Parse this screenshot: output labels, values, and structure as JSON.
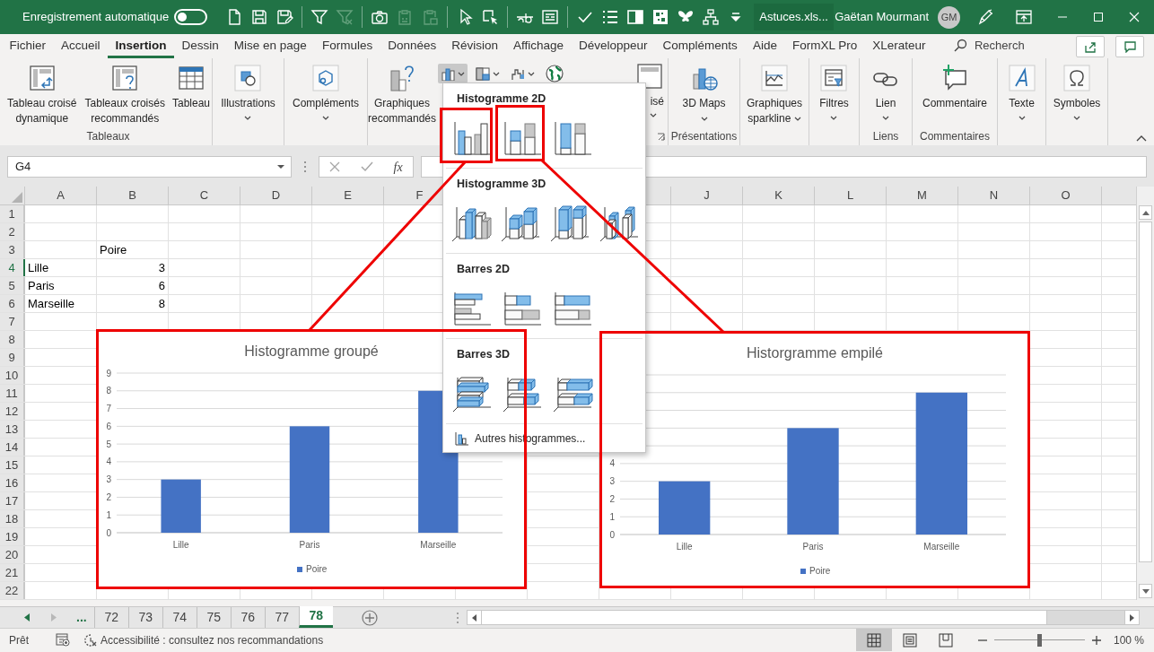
{
  "title_bar": {
    "autosave": {
      "label": "Enregistrement automatique",
      "on": false
    },
    "quick_access": [
      {
        "tools": [
          {
            "kind": "new-file",
            "disabled": false
          },
          {
            "kind": "save",
            "disabled": false
          },
          {
            "kind": "save-as",
            "disabled": false
          }
        ]
      },
      {
        "tools": [
          {
            "kind": "filter",
            "disabled": false
          },
          {
            "kind": "clear-filter",
            "disabled": true
          }
        ]
      },
      {
        "tools": [
          {
            "kind": "camera",
            "disabled": false
          },
          {
            "kind": "clipboard-numbers",
            "disabled": true
          },
          {
            "kind": "clipboard-picture",
            "disabled": true
          }
        ]
      },
      {
        "tools": [
          {
            "kind": "pointer",
            "disabled": false
          },
          {
            "kind": "select-objects",
            "disabled": false
          }
        ]
      },
      {
        "tools": [
          {
            "kind": "strikethrough",
            "disabled": false
          },
          {
            "kind": "form",
            "disabled": false
          }
        ]
      },
      {
        "tools": [
          {
            "kind": "check",
            "disabled": false
          },
          {
            "kind": "list",
            "disabled": false
          },
          {
            "kind": "layout",
            "disabled": false
          },
          {
            "kind": "checker",
            "disabled": false
          },
          {
            "kind": "butterfly",
            "disabled": false
          },
          {
            "kind": "org-chart",
            "disabled": false
          },
          {
            "kind": "more",
            "disabled": false
          }
        ]
      }
    ],
    "file_name": "Astuces.xls...",
    "user": "Gaëtan Mourmant",
    "avatar": "GM"
  },
  "tabs": [
    {
      "label": "Fichier",
      "selected": false
    },
    {
      "label": "Accueil",
      "selected": false
    },
    {
      "label": "Insertion",
      "selected": true
    },
    {
      "label": "Dessin",
      "selected": false
    },
    {
      "label": "Mise en page",
      "selected": false
    },
    {
      "label": "Formules",
      "selected": false
    },
    {
      "label": "Données",
      "selected": false
    },
    {
      "label": "Révision",
      "selected": false
    },
    {
      "label": "Affichage",
      "selected": false
    },
    {
      "label": "Développeur",
      "selected": false
    },
    {
      "label": "Compléments",
      "selected": false
    },
    {
      "label": "Aide",
      "selected": false
    },
    {
      "label": "FormXL Pro",
      "selected": false
    },
    {
      "label": "XLerateur",
      "selected": false
    }
  ],
  "search": {
    "placeholder": "Recherch"
  },
  "ribbon": {
    "groups": [
      {
        "kind": "tables",
        "label": "Tableaux",
        "buttons": [
          {
            "kind": "pivot-table",
            "label": "Tableau croisé dynamique",
            "dropdown": false
          },
          {
            "kind": "recommended-pivot",
            "label": "Tableaux croisés recommandés",
            "dropdown": false
          },
          {
            "kind": "table",
            "label": "Tableau",
            "dropdown": false
          }
        ]
      },
      {
        "kind": "illustrations",
        "buttons": [
          {
            "kind": "shapes",
            "label": "Illustrations",
            "dropdown": true
          }
        ]
      },
      {
        "kind": "addins",
        "buttons": [
          {
            "kind": "addins",
            "label": "Compléments",
            "dropdown": true
          }
        ]
      },
      {
        "kind": "charts",
        "buttons": [
          {
            "kind": "recommended-charts",
            "label": "Graphiques recommandés",
            "dropdown": false
          }
        ],
        "small_buttons": [
          {
            "kind": "column",
            "pressed": true
          },
          {
            "kind": "hierarchy",
            "pressed": false
          },
          {
            "kind": "waterfall",
            "pressed": false
          },
          {
            "kind": "map",
            "pressed": false
          }
        ],
        "pivot_chart": {
          "label": "isé",
          "dropdown": true
        }
      },
      {
        "kind": "tours",
        "label": "Présentations",
        "buttons": [
          {
            "kind": "maps",
            "label": "3D Maps",
            "dropdown": true
          }
        ]
      },
      {
        "kind": "sparklines",
        "buttons": [
          {
            "kind": "sparkline",
            "label": "Graphiques sparkline",
            "dropdown": true
          }
        ]
      },
      {
        "kind": "filters",
        "buttons": [
          {
            "kind": "slicer",
            "label": "Filtres",
            "dropdown": true
          }
        ]
      },
      {
        "kind": "links",
        "label": "Liens",
        "buttons": [
          {
            "kind": "link",
            "label": "Lien",
            "dropdown": true
          }
        ]
      },
      {
        "kind": "comments",
        "label": "Commentaires",
        "buttons": [
          {
            "kind": "comment",
            "label": "Commentaire",
            "dropdown": false
          }
        ]
      },
      {
        "kind": "text",
        "buttons": [
          {
            "kind": "text",
            "label": "Texte",
            "dropdown": true
          }
        ]
      },
      {
        "kind": "symbols",
        "buttons": [
          {
            "kind": "symbol",
            "label": "Symboles",
            "dropdown": true
          }
        ]
      }
    ]
  },
  "formula_bar": {
    "name_box": "G4",
    "function_button": "fx"
  },
  "sheet": {
    "columns": [
      "A",
      "B",
      "C",
      "D",
      "E",
      "F",
      null,
      null,
      null,
      "J",
      "K",
      "L",
      "M",
      "N",
      "O"
    ],
    "rows": [
      {
        "header": "1",
        "active": false
      },
      {
        "header": "2",
        "active": false
      },
      {
        "header": "3",
        "active": false,
        "cells": [
          null,
          {
            "value": "Poire",
            "kind": "text"
          }
        ]
      },
      {
        "header": "4",
        "active": true,
        "cells": [
          {
            "value": "Lille",
            "kind": "text"
          },
          {
            "value": "3",
            "kind": "number"
          }
        ]
      },
      {
        "header": "5",
        "active": false,
        "cells": [
          {
            "value": "Paris",
            "kind": "text"
          },
          {
            "value": "6",
            "kind": "number"
          }
        ]
      },
      {
        "header": "6",
        "active": false,
        "cells": [
          {
            "value": "Marseille",
            "kind": "text"
          },
          {
            "value": "8",
            "kind": "number"
          }
        ]
      },
      {
        "header": "7",
        "active": false
      },
      {
        "header": "8",
        "active": false
      },
      {
        "header": "9",
        "active": false
      },
      {
        "header": "10",
        "active": false
      },
      {
        "header": "11",
        "active": false
      },
      {
        "header": "12",
        "active": false
      },
      {
        "header": "13",
        "active": false
      },
      {
        "header": "14",
        "active": false
      },
      {
        "header": "15",
        "active": false
      },
      {
        "header": "16",
        "active": false
      },
      {
        "header": "17",
        "active": false
      },
      {
        "header": "18",
        "active": false
      },
      {
        "header": "19",
        "active": false
      },
      {
        "header": "20",
        "active": false
      },
      {
        "header": "21",
        "active": false
      },
      {
        "header": "22",
        "active": false
      }
    ]
  },
  "charts": [
    {
      "chart_data": {
        "type": "bar",
        "title": "Histogramme groupé",
        "categories": [
          "Lille",
          "Paris",
          "Marseille"
        ],
        "series": [
          {
            "name": "Poire",
            "color": "#4472c4",
            "values": [
              3,
              6,
              8
            ]
          }
        ],
        "ylim": [
          0,
          9
        ],
        "yticks": [
          0,
          1,
          2,
          3,
          4,
          5,
          6,
          7,
          8,
          9
        ],
        "grid": true,
        "stacked": false
      }
    },
    {
      "chart_data": {
        "type": "bar",
        "title": "Historgramme empilé",
        "categories": [
          "Lille",
          "Paris",
          "Marseille"
        ],
        "series": [
          {
            "name": "Poire",
            "color": "#4472c4",
            "values": [
              3,
              6,
              8
            ]
          }
        ],
        "ylim": [
          0,
          9
        ],
        "yticks": [
          0,
          1,
          2,
          3,
          4
        ],
        "grid": true,
        "stacked": true
      }
    }
  ],
  "chart_menu": {
    "sections": [
      {
        "title": "Histogramme 2D",
        "items": [
          {
            "kind": "clustered-column"
          },
          {
            "kind": "stacked-column"
          },
          {
            "kind": "stacked100-column"
          }
        ]
      },
      {
        "title": "Histogramme 3D",
        "items": [
          {
            "kind": "deep-clustered-column"
          },
          {
            "kind": "deep-stacked-column"
          },
          {
            "kind": "deep-stacked100-column"
          },
          {
            "kind": "deep-column"
          }
        ]
      },
      {
        "title": "Barres 2D",
        "items": [
          {
            "kind": "clustered-bar"
          },
          {
            "kind": "stacked-bar"
          },
          {
            "kind": "stacked100-bar"
          }
        ]
      },
      {
        "title": "Barres 3D",
        "items": [
          {
            "kind": "deep-clustered-bar"
          },
          {
            "kind": "deep-stacked-bar"
          },
          {
            "kind": "deep-stacked100-bar"
          }
        ]
      }
    ],
    "footer": "Autres histogrammes..."
  },
  "sheet_tabs": {
    "overflow": "...",
    "tabs": [
      {
        "label": "72",
        "selected": false
      },
      {
        "label": "73",
        "selected": false
      },
      {
        "label": "74",
        "selected": false
      },
      {
        "label": "75",
        "selected": false
      },
      {
        "label": "76",
        "selected": false
      },
      {
        "label": "77",
        "selected": false
      },
      {
        "label": "78",
        "selected": true
      }
    ]
  },
  "status_bar": {
    "status": "Prêt",
    "accessibility": "Accessibilité : consultez nos recommandations",
    "views": [
      {
        "kind": "normal",
        "selected": true
      },
      {
        "kind": "page-layout",
        "selected": false
      },
      {
        "kind": "page-break",
        "selected": false
      }
    ],
    "zoom": {
      "level": 0.5,
      "reading": "100 %"
    }
  }
}
